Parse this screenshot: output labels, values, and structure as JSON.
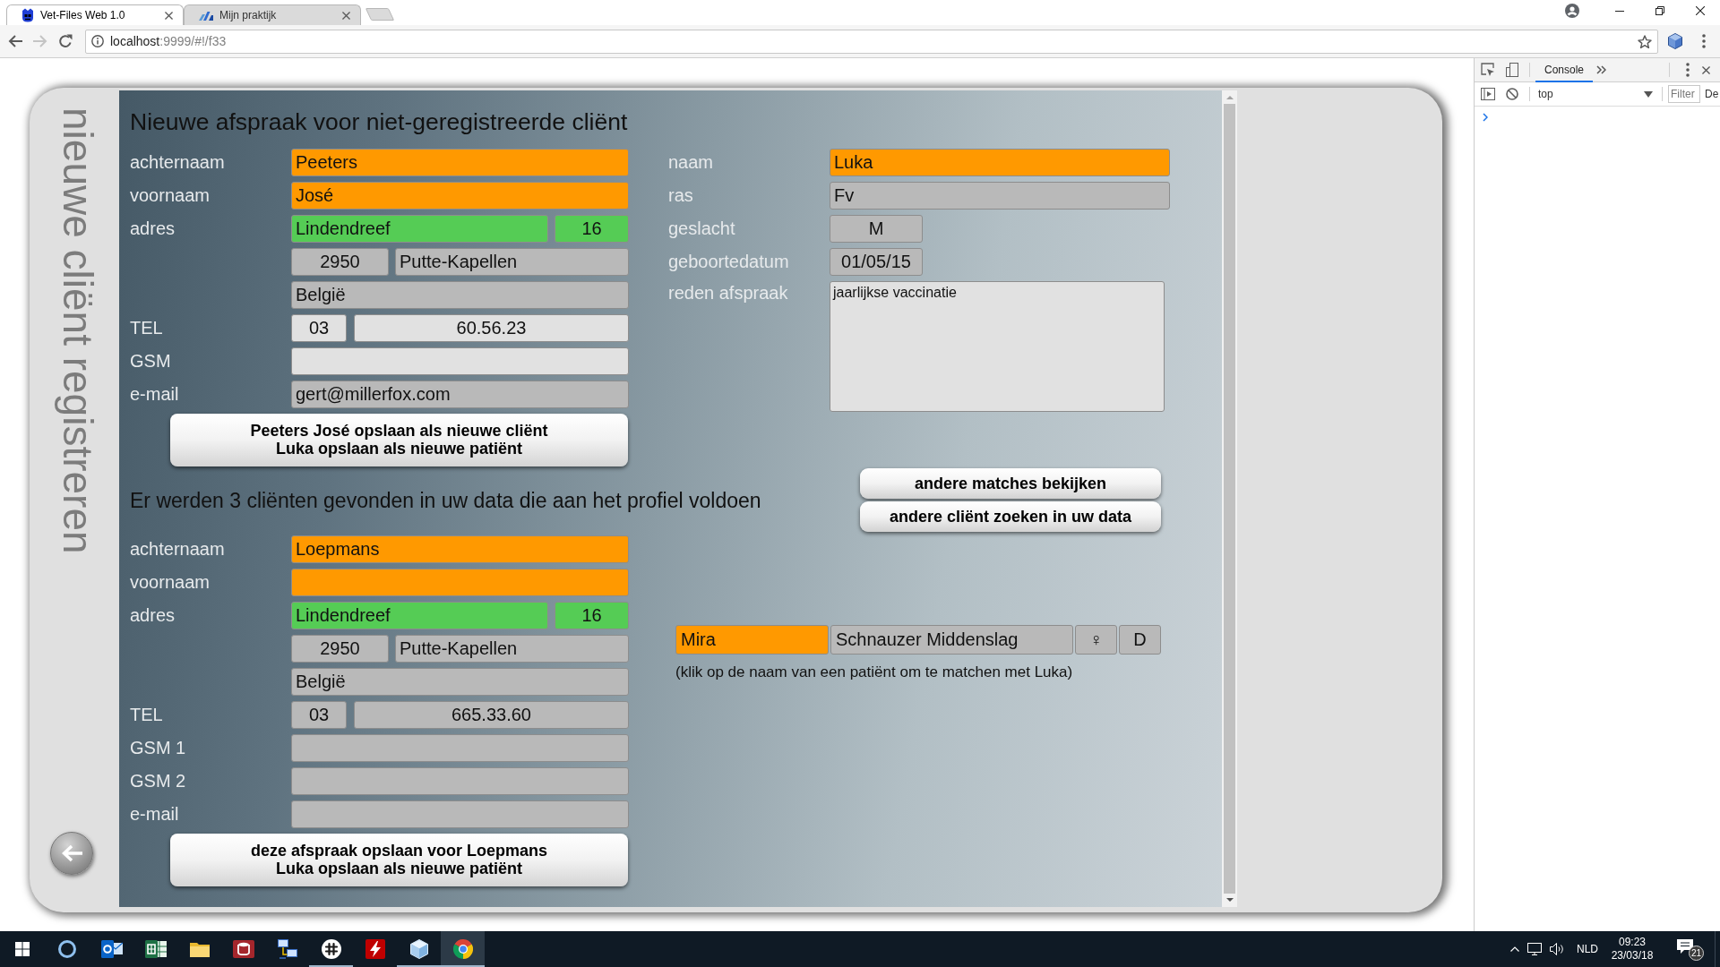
{
  "browser": {
    "tabs": [
      {
        "title": "Vet-Files Web 1.0",
        "selected": true
      },
      {
        "title": "Mijn praktijk",
        "selected": false
      }
    ],
    "nav_buttons": [
      {
        "disabled": false
      },
      {
        "disabled": true
      }
    ],
    "address": {
      "host": "localhost",
      "path": ":9999/#!/f33"
    }
  },
  "app": {
    "side_title": "nieuwe cliënt registreren",
    "new_appointment": {
      "heading": "Nieuwe afspraak voor niet-geregistreerde cliënt",
      "client_rows": [
        {
          "label": "achternaam",
          "kind": "single",
          "fields": [
            {
              "value": "Peeters",
              "color": "#ff9900"
            }
          ]
        },
        {
          "label": "voornaam",
          "kind": "single",
          "fields": [
            {
              "value": "José",
              "color": "#ff9900"
            }
          ]
        },
        {
          "label": "adres",
          "kind": "street",
          "fields": [
            {
              "value": "Lindendreef",
              "color": "#55cc55"
            },
            {
              "value": "16",
              "color": "#55cc55"
            }
          ]
        },
        {
          "kind": "city",
          "fields": [
            {
              "value": "2950",
              "color": "#b9b9b9"
            },
            {
              "value": "Putte-Kapellen",
              "color": "#b9b9b9"
            }
          ]
        },
        {
          "kind": "single",
          "fields": [
            {
              "value": "België",
              "color": "#b9b9b9"
            }
          ]
        },
        {
          "label": "TEL",
          "kind": "phone",
          "fields": [
            {
              "value": "03",
              "color": "#e1e1e1"
            },
            {
              "value": "60.56.23",
              "color": "#e1e1e1"
            }
          ]
        },
        {
          "label": "GSM",
          "kind": "single",
          "fields": [
            {
              "color": "#e1e1e1"
            }
          ]
        },
        {
          "label": "e-mail",
          "kind": "single",
          "fields": [
            {
              "value": "gert@millerfox.com",
              "color": "#b9b9b9"
            }
          ]
        }
      ],
      "save_button": {
        "lines": [
          "Peeters José opslaan als nieuwe cliënt",
          "Luka opslaan als nieuwe patiënt"
        ]
      },
      "patient_rows": [
        {
          "label": "naam",
          "kind": "single",
          "fields": [
            {
              "value": "Luka",
              "color": "#ff9900"
            }
          ]
        },
        {
          "label": "ras",
          "kind": "single",
          "fields": [
            {
              "value": "Fv",
              "color": "#b9b9b9"
            }
          ]
        },
        {
          "label": "geslacht",
          "kind": "short",
          "fields": [
            {
              "value": "M",
              "color": "#b9b9b9"
            }
          ]
        },
        {
          "label": "geboortedatum",
          "kind": "short",
          "fields": [
            {
              "value": "01/05/15",
              "color": "#b9b9b9"
            }
          ]
        },
        {
          "label": "reden afspraak",
          "kind": "textarea",
          "fields": [
            {
              "value": "jaarlijkse vaccinatie",
              "color": "#e1e1e1"
            }
          ]
        }
      ]
    },
    "match_buttons": [
      "andere matches bekijken",
      "andere cliënt zoeken in uw data"
    ],
    "matches": {
      "heading": "Er werden 3 cliënten gevonden in uw data die aan het profiel voldoen",
      "client_rows": [
        {
          "label": "achternaam",
          "kind": "single",
          "fields": [
            {
              "value": "Loepmans",
              "color": "#ff9900"
            }
          ]
        },
        {
          "label": "voornaam",
          "kind": "single",
          "fields": [
            {
              "color": "#ff9900"
            }
          ]
        },
        {
          "label": "adres",
          "kind": "street",
          "fields": [
            {
              "value": "Lindendreef",
              "color": "#55cc55"
            },
            {
              "value": "16",
              "color": "#55cc55"
            }
          ]
        },
        {
          "kind": "city",
          "fields": [
            {
              "value": "2950",
              "color": "#b9b9b9"
            },
            {
              "value": "Putte-Kapellen",
              "color": "#b9b9b9"
            }
          ]
        },
        {
          "kind": "single",
          "fields": [
            {
              "value": "België",
              "color": "#b9b9b9"
            }
          ]
        },
        {
          "label": "TEL",
          "kind": "phone",
          "fields": [
            {
              "value": "03",
              "color": "#b9b9b9"
            },
            {
              "value": "665.33.60",
              "color": "#b9b9b9"
            }
          ]
        },
        {
          "label": "GSM 1",
          "kind": "single",
          "fields": [
            {
              "color": "#b9b9b9"
            }
          ]
        },
        {
          "label": "GSM 2",
          "kind": "single",
          "fields": [
            {
              "color": "#b9b9b9"
            }
          ]
        },
        {
          "label": "e-mail",
          "kind": "single",
          "fields": [
            {
              "color": "#b9b9b9"
            }
          ]
        }
      ],
      "save_button": {
        "lines": [
          "deze afspraak opslaan voor Loepmans",
          "Luka opslaan als nieuwe patiënt"
        ]
      },
      "patients": [
        {
          "cells": [
            {
              "value": "Mira",
              "color": "#ff9900"
            },
            {
              "value": "Schnauzer Middenslag",
              "color": "#b9b9b9"
            },
            {
              "value": "♀",
              "color": "#b9b9b9"
            },
            {
              "value": "D",
              "color": "#b9b9b9"
            }
          ]
        }
      ],
      "hint": "(klik op de naam van een patiënt om te matchen met Luka)"
    }
  },
  "devtools": {
    "tabs": [
      {
        "label": "Console",
        "selected": true
      }
    ],
    "context": "top",
    "filter": {
      "placeholder": "Filter"
    },
    "levels": "De"
  },
  "taskbar": {
    "apps": [
      {
        "running": false,
        "selected": false
      },
      {
        "running": false,
        "selected": false
      },
      {
        "running": false,
        "selected": false
      },
      {
        "running": false,
        "selected": false
      },
      {
        "running": false,
        "selected": false
      },
      {
        "running": true,
        "selected": false
      },
      {
        "running": false,
        "selected": false
      },
      {
        "running": true,
        "selected": false
      },
      {
        "running": true,
        "selected": true
      }
    ],
    "language": "NLD",
    "time": "09:23",
    "date": "23/03/18",
    "notifications": "21"
  }
}
